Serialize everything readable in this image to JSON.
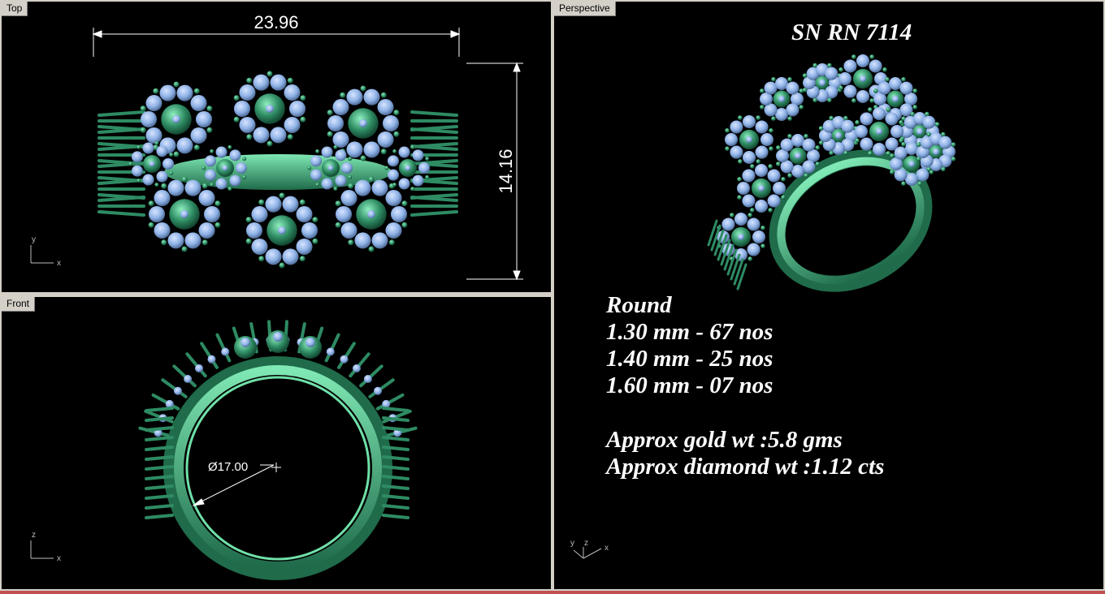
{
  "viewports": {
    "top": {
      "label": "Top",
      "dimension_width": "23.96",
      "dimension_height": "14.16",
      "axis_y": "y",
      "axis_x": "x"
    },
    "front": {
      "label": "Front",
      "diameter": "Ø17.00",
      "axis_z": "z",
      "axis_x": "x"
    },
    "perspective": {
      "label": "Perspective",
      "title": "SN RN 7114",
      "stone_heading": "Round",
      "stones": [
        "1.30 mm - 67 nos",
        "1.40 mm - 25 nos",
        "1.60 mm - 07 nos"
      ],
      "gold_weight": "Approx gold wt :5.8 gms",
      "diamond_weight": "Approx diamond wt :1.12 cts",
      "axis_y": "y",
      "axis_z": "z",
      "axis_x": "x"
    }
  },
  "colors": {
    "metal": "#2e8b63",
    "metal_light": "#5fcf9a",
    "stone": "#8fb2e6",
    "background": "#000000"
  }
}
